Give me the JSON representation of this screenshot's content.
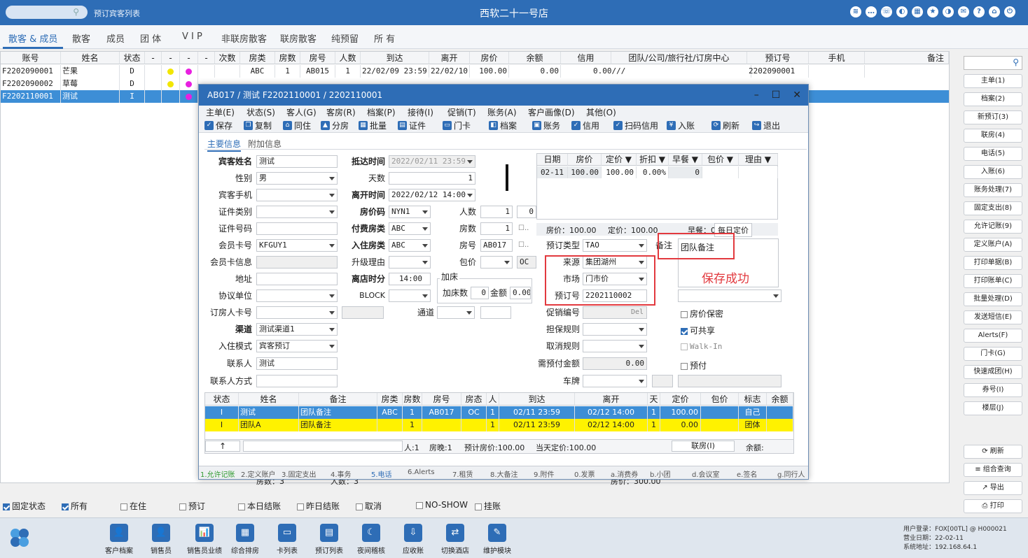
{
  "header": {
    "breadcrumb": "预订宾客列表",
    "title": "西软二十一号店",
    "icons": [
      "wifi-icon",
      "chat-icon",
      "phone-icon",
      "palette-icon",
      "grid-icon",
      "star-icon",
      "theme-icon",
      "mail-icon",
      "help-icon",
      "home-icon",
      "power-icon"
    ]
  },
  "nav_tabs": [
    "散客 & 成员",
    "散客",
    "成员",
    "团 体",
    "V I P",
    "非联房散客",
    "联房散客",
    "纯预留",
    "所 有"
  ],
  "main_table": {
    "headers": [
      "账号",
      "姓名",
      "状态",
      "-",
      "-",
      "-",
      "-",
      "次数",
      "房类",
      "房数",
      "房号",
      "人数",
      "到达",
      "离开",
      "房价",
      "余额",
      "信用",
      "团队/公司/旅行社/订房中心",
      "预订号",
      "手机",
      "备注"
    ],
    "rows": [
      [
        "F2202090001",
        "芒果",
        "D",
        "",
        "",
        "",
        "",
        "",
        "ABC",
        "1",
        "AB015",
        "1",
        "22/02/09 23:59",
        "22/02/10",
        "100.00",
        "0.00",
        "0.00///",
        "",
        "2202090001",
        "",
        ""
      ],
      [
        "F2202090002",
        "草莓",
        "D",
        "",
        "",
        "",
        "",
        "",
        "",
        "",
        "",
        "",
        "",
        "",
        "",
        "",
        "",
        "",
        "",
        "",
        ""
      ],
      [
        "F2202110001",
        "测试",
        "I",
        "",
        "",
        "",
        "",
        "",
        "",
        "",
        "",
        "",
        "",
        "",
        "",
        "",
        "",
        "",
        "",
        "",
        ""
      ]
    ],
    "summary": {
      "rooms": "房数：3",
      "people": "人数：3",
      "price": "房价：300.00"
    }
  },
  "filters": [
    {
      "label": "固定状态",
      "checked": true
    },
    {
      "label": "所有",
      "checked": true
    },
    {
      "label": "在住",
      "checked": false
    },
    {
      "label": "预订",
      "checked": false
    },
    {
      "label": "本日结账",
      "checked": false
    },
    {
      "label": "昨日结账",
      "checked": false
    },
    {
      "label": "取消",
      "checked": false
    },
    {
      "label": "NO-SHOW",
      "checked": false
    },
    {
      "label": "挂账",
      "checked": false
    }
  ],
  "right_panel": {
    "buttons": [
      "主单(1)",
      "档案(2)",
      "新预订(3)",
      "联房(4)",
      "电话(5)",
      "入账(6)",
      "账务处理(7)",
      "固定支出(8)",
      "允许记账(9)",
      "定义账户(A)",
      "打印单据(B)",
      "打印账单(C)",
      "批量处理(D)",
      "发送短信(E)",
      "Alerts(F)",
      "门卡(G)",
      "快速成团(H)",
      "券号(I)",
      "楼层(J)"
    ],
    "actions": [
      "刷新",
      "组合查询",
      "导出",
      "打印"
    ]
  },
  "bottom_bar": {
    "items": [
      "客户档案",
      "销售员",
      "销售员业绩",
      "综合排房",
      "卡列表",
      "预订列表",
      "夜间稽核",
      "应收账",
      "切换酒店",
      "维护模块"
    ],
    "user": "用户登录：FOX[00TL] @ H000021",
    "date": "营业日期：22-02-11",
    "ip": "系统地址：192.168.64.1"
  },
  "dialog": {
    "title": "AB017 / 测试 F2202110001 / 2202110001",
    "menu": [
      "主单(E)",
      "状态(S)",
      "客人(G)",
      "客房(R)",
      "档案(P)",
      "接待(I)",
      "促销(T)",
      "账务(A)",
      "客户画像(D)",
      "其他(O)"
    ],
    "toolbar": [
      "保存",
      "复制",
      "同住",
      "分房",
      "批量",
      "证件",
      "门卡",
      "档案",
      "账务",
      "信用",
      "扫码信用",
      "入账",
      "刷新",
      "退出"
    ],
    "tabs": [
      "主要信息",
      "附加信息"
    ],
    "form": {
      "guest_name": {
        "label": "宾客姓名",
        "value": "测试"
      },
      "gender": {
        "label": "性别",
        "value": "男"
      },
      "mobile": {
        "label": "宾客手机",
        "value": ""
      },
      "id_type": {
        "label": "证件类别",
        "value": ""
      },
      "id_no": {
        "label": "证件号码",
        "value": ""
      },
      "member_card": {
        "label": "会员卡号",
        "value": "KFGUY1"
      },
      "member_info": {
        "label": "会员卡信息",
        "value": ""
      },
      "address": {
        "label": "地址",
        "value": ""
      },
      "agreement": {
        "label": "协议单位",
        "value": ""
      },
      "booker_card": {
        "label": "订房人卡号",
        "value": ""
      },
      "channel": {
        "label": "渠道",
        "value": "测试渠道1"
      },
      "checkin_mode": {
        "label": "入住模式",
        "value": "宾客预订"
      },
      "contact": {
        "label": "联系人",
        "value": "测试"
      },
      "contact_method": {
        "label": "联系人方式",
        "value": ""
      },
      "arrival": {
        "label": "抵达时间",
        "value": "2022/02/11 23:59"
      },
      "days": {
        "label": "天数",
        "value": "1"
      },
      "departure": {
        "label": "离开时间",
        "value": "2022/02/12 14:00"
      },
      "rate_code": {
        "label": "房价码",
        "value": "NYN1"
      },
      "pay_type": {
        "label": "付费房类",
        "value": "ABC"
      },
      "room_type": {
        "label": "入住房类",
        "value": "ABC"
      },
      "upgrade": {
        "label": "升级理由",
        "value": ""
      },
      "checkout_time": {
        "label": "离店时分",
        "value": "14:00"
      },
      "block": {
        "label": "BLOCK",
        "value": ""
      },
      "passage": {
        "label": "通道",
        "value": ""
      },
      "people": {
        "label": "人数",
        "value": "1",
        "value2": "0"
      },
      "rooms": {
        "label": "房数",
        "value": "1"
      },
      "room_no": {
        "label": "房号",
        "value": "AB017"
      },
      "package": {
        "label": "包价",
        "value": "",
        "status": "OC"
      },
      "extra_bed": {
        "title": "加床",
        "count_label": "加床数",
        "count": "0",
        "amount_label": "金额",
        "amount": "0.00"
      },
      "resv_type": {
        "label": "预订类型",
        "value": "TAO"
      },
      "source": {
        "label": "来源",
        "value": "集团湖州"
      },
      "market": {
        "label": "市场",
        "value": "门市价"
      },
      "resv_no": {
        "label": "预订号",
        "value": "2202110002"
      },
      "promo": {
        "label": "促销编号",
        "button": "Del"
      },
      "guarantee": {
        "label": "担保规则",
        "value": ""
      },
      "cancel": {
        "label": "取消规则",
        "value": ""
      },
      "prepay": {
        "label": "需预付金额",
        "value": "0.00"
      },
      "plate": {
        "label": "车牌",
        "value": ""
      },
      "remark": {
        "label": "备注",
        "value": "团队备注"
      },
      "save_msg": "保存成功",
      "price_secret": {
        "label": "房价保密",
        "checked": false
      },
      "shareable": {
        "label": "可共享",
        "checked": true
      },
      "walkin": {
        "label": "Walk-In",
        "checked": false
      },
      "prebook": {
        "label": "预付",
        "checked": false
      }
    },
    "rate_grid": {
      "headers": [
        "日期",
        "房价",
        "定价 ▼",
        "折扣 ▼",
        "早餐 ▼",
        "包价 ▼",
        "理由 ▼"
      ],
      "row": [
        "02-11",
        "100.00",
        "100.00",
        "0.00%",
        "0",
        "",
        ""
      ],
      "summary_price": "房价：100.00",
      "summary_rate": "定价：100.00",
      "summary_bf": "早餐：0",
      "daily_btn": "每日定价"
    },
    "lower_grid": {
      "headers": [
        "状态",
        "姓名",
        "备注",
        "房类",
        "房数",
        "房号",
        "房态",
        "人",
        "到达",
        "离开",
        "天",
        "定价",
        "包价",
        "标志",
        "余额"
      ],
      "rows": [
        [
          "I",
          "测试",
          "团队备注",
          "ABC",
          "1",
          "AB017",
          "OC",
          "1",
          "02/11 23:59",
          "02/12 14:00",
          "1",
          "100.00",
          "",
          "自己",
          ""
        ],
        [
          "I",
          "团队A",
          "团队备注",
          "",
          "1",
          "",
          "",
          "1",
          "02/11 23:59",
          "02/12 14:00",
          "1",
          "0.00",
          "",
          "团体",
          ""
        ]
      ],
      "footer": {
        "people": "人:1",
        "nights": "房晚:1",
        "price": "预计房价:100.00",
        "today": "当天定价:100.00",
        "link_btn": "联房(I)",
        "balance": "余额:"
      }
    },
    "bottom_tabs": [
      "1.允许记账",
      "2.定义账户",
      "3.固定支出",
      "4.事务",
      "5.电话",
      "6.Alerts",
      "7.租赁",
      "8.大备注",
      "9.附件",
      "0.发票",
      "a.消费券",
      "b.小团",
      "d.会议室",
      "e.签名",
      "g.同行人"
    ]
  }
}
